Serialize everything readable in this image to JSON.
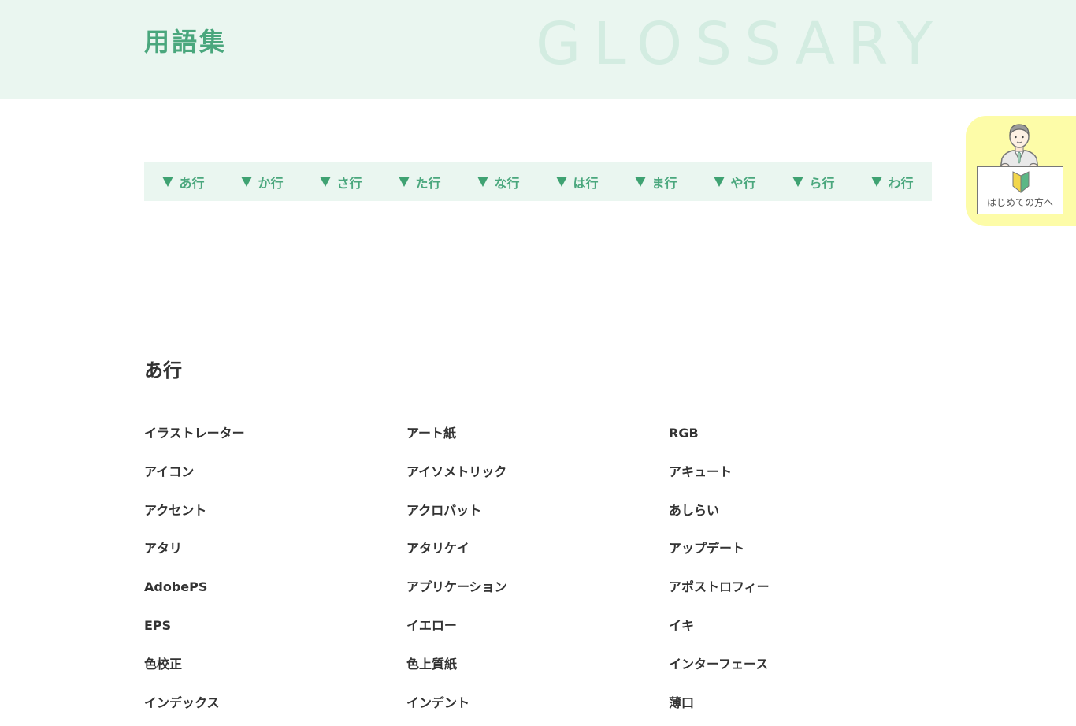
{
  "header": {
    "title": "用語集",
    "watermark": "GLOSSARY"
  },
  "index_nav": {
    "items": [
      {
        "label": "あ行"
      },
      {
        "label": "か行"
      },
      {
        "label": "さ行"
      },
      {
        "label": "た行"
      },
      {
        "label": "な行"
      },
      {
        "label": "は行"
      },
      {
        "label": "ま行"
      },
      {
        "label": "や行"
      },
      {
        "label": "ら行"
      },
      {
        "label": "わ行"
      }
    ]
  },
  "section": {
    "heading": "あ行",
    "terms": [
      "イラストレーター",
      "アート紙",
      "RGB",
      "アイコン",
      "アイソメトリック",
      "アキュート",
      "アクセント",
      "アクロバット",
      "あしらい",
      "アタリ",
      "アタリケイ",
      "アップデート",
      "AdobePS",
      "アプリケーション",
      "アポストロフィー",
      "EPS",
      "イエロー",
      "イキ",
      "色校正",
      "色上質紙",
      "インターフェース",
      "インデックス",
      "インデント",
      "薄口"
    ]
  },
  "side_tab": {
    "label": "はじめての方へ"
  },
  "colors": {
    "accent": "#4aa77d",
    "hero_bg": "#eaf6f0",
    "side_tab_bg": "#fdfca8"
  }
}
